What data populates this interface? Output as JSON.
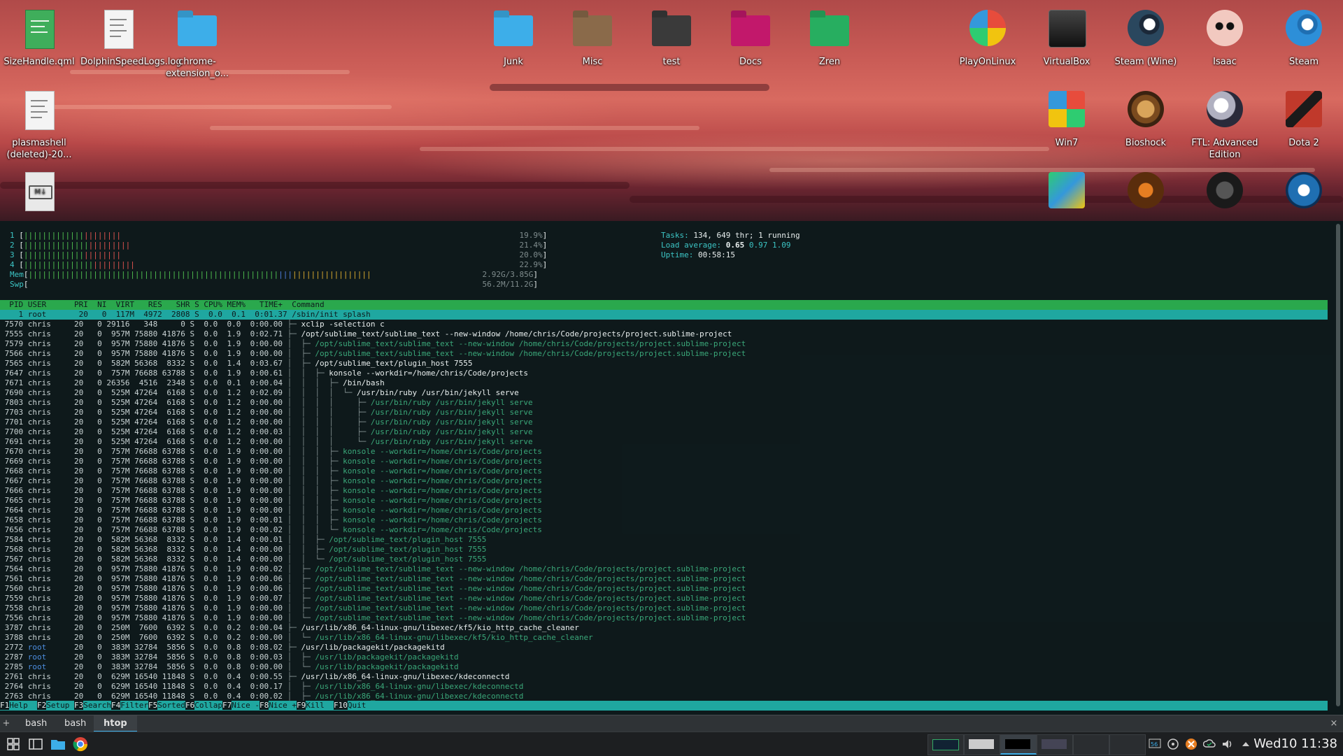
{
  "desktop": {
    "left_icons": [
      {
        "label": "SizeHandle.qml",
        "icon": "qml-file-icon"
      },
      {
        "label": "DolphinSpeedLogs.log",
        "icon": "log-file-icon"
      },
      {
        "label": "chrome-extension_o...",
        "icon": "folder-icon"
      },
      {
        "label": "plasmashell (deleted)-20...",
        "icon": "text-file-icon"
      },
      {
        "label": "",
        "icon": "markdown-file-icon"
      }
    ],
    "folders": [
      {
        "label": "Junk",
        "color": "#3daee9"
      },
      {
        "label": "Misc",
        "color": "#8a6a4a"
      },
      {
        "label": "test",
        "color": "#3a3a3a"
      },
      {
        "label": "Docs",
        "color": "#c2186b"
      },
      {
        "label": "Zren",
        "color": "#27ae60"
      }
    ],
    "apps_row1": [
      {
        "label": "PlayOnLinux",
        "icon": "playonlinux-icon"
      },
      {
        "label": "VirtualBox",
        "icon": "virtualbox-icon"
      },
      {
        "label": "Steam (Wine)",
        "icon": "steam-icon"
      },
      {
        "label": "Isaac",
        "icon": "isaac-icon"
      },
      {
        "label": "Steam",
        "icon": "steam-icon"
      }
    ],
    "apps_row2": [
      {
        "label": "Win7",
        "icon": "win7-icon"
      },
      {
        "label": "Bioshock",
        "icon": "bioshock-icon"
      },
      {
        "label": "FTL: Advanced Edition",
        "icon": "ftl-icon"
      },
      {
        "label": "Dota 2",
        "icon": "dota2-icon"
      }
    ],
    "apps_row3": [
      {
        "label": "",
        "icon": "game-icon"
      },
      {
        "label": "",
        "icon": "torchlight-icon"
      },
      {
        "label": "",
        "icon": "witcher-icon"
      },
      {
        "label": "",
        "icon": "rocket-league-icon"
      }
    ]
  },
  "htop": {
    "cpu_meters": [
      {
        "id": "1",
        "percent": "19.9%",
        "fill": 0.199
      },
      {
        "id": "2",
        "percent": "21.4%",
        "fill": 0.214
      },
      {
        "id": "3",
        "percent": "20.0%",
        "fill": 0.2
      },
      {
        "id": "4",
        "percent": "22.9%",
        "fill": 0.229
      }
    ],
    "mem": {
      "label": "Mem",
      "used": "2.92G",
      "total": "3.85G",
      "fill": 0.76
    },
    "swp": {
      "label": "Swp",
      "used": "56.2M",
      "total": "11.2G",
      "fill": 0.005
    },
    "tasks_label": "Tasks: ",
    "tasks_value": "134, 649 thr; 1 running",
    "load_label": "Load average: ",
    "load_1": "0.65",
    "load_rest": "0.97 1.09",
    "uptime_label": "Uptime: ",
    "uptime_value": "00:58:15",
    "header": "  PID USER      PRI  NI  VIRT   RES   SHR S CPU% MEM%   TIME+  Command",
    "selected_row": "    1 root       20   0  117M  4972  2808 S  0.0  0.1  0:01.37 /sbin/init splash",
    "rows": [
      {
        "pid": "7570",
        "user": "chris",
        "virt": "29116",
        "res": "348",
        "shr": "0",
        "cpu": "0.0",
        "mem": "0.0",
        "time": "0:00.00",
        "tree": "├─ ",
        "cmd": "xclip -selection c",
        "child": false
      },
      {
        "pid": "7555",
        "user": "chris",
        "virt": "957M",
        "res": "75880",
        "shr": "41876",
        "cpu": "0.0",
        "mem": "1.9",
        "time": "0:02.71",
        "tree": "├─ ",
        "cmd": "/opt/sublime_text/sublime_text --new-window /home/chris/Code/projects/project.sublime-project",
        "child": false
      },
      {
        "pid": "7579",
        "user": "chris",
        "virt": "957M",
        "res": "75880",
        "shr": "41876",
        "cpu": "0.0",
        "mem": "1.9",
        "time": "0:00.00",
        "tree": "│  ├─ ",
        "cmd": "/opt/sublime_text/sublime_text --new-window /home/chris/Code/projects/project.sublime-project",
        "child": true
      },
      {
        "pid": "7566",
        "user": "chris",
        "virt": "957M",
        "res": "75880",
        "shr": "41876",
        "cpu": "0.0",
        "mem": "1.9",
        "time": "0:00.00",
        "tree": "│  ├─ ",
        "cmd": "/opt/sublime_text/sublime_text --new-window /home/chris/Code/projects/project.sublime-project",
        "child": true
      },
      {
        "pid": "7565",
        "user": "chris",
        "virt": "582M",
        "res": "56368",
        "shr": "8332",
        "cpu": "0.0",
        "mem": "1.4",
        "time": "0:03.67",
        "tree": "│  ├─ ",
        "cmd": "/opt/sublime_text/plugin_host 7555",
        "child": false
      },
      {
        "pid": "7647",
        "user": "chris",
        "virt": "757M",
        "res": "76688",
        "shr": "63788",
        "cpu": "0.0",
        "mem": "1.9",
        "time": "0:00.61",
        "tree": "│  │  ├─ ",
        "cmd": "konsole --workdir=/home/chris/Code/projects",
        "child": false
      },
      {
        "pid": "7671",
        "user": "chris",
        "virt": "26356",
        "res": "4516",
        "shr": "2348",
        "cpu": "0.0",
        "mem": "0.1",
        "time": "0:00.04",
        "tree": "│  │  │  ├─ ",
        "cmd": "/bin/bash",
        "child": false
      },
      {
        "pid": "7690",
        "user": "chris",
        "virt": "525M",
        "res": "47264",
        "shr": "6168",
        "cpu": "0.0",
        "mem": "1.2",
        "time": "0:02.09",
        "tree": "│  │  │  │  └─ ",
        "cmd": "/usr/bin/ruby /usr/bin/jekyll serve",
        "child": false
      },
      {
        "pid": "7803",
        "user": "chris",
        "virt": "525M",
        "res": "47264",
        "shr": "6168",
        "cpu": "0.0",
        "mem": "1.2",
        "time": "0:00.00",
        "tree": "│  │  │  │     ├─ ",
        "cmd": "/usr/bin/ruby /usr/bin/jekyll serve",
        "child": true
      },
      {
        "pid": "7703",
        "user": "chris",
        "virt": "525M",
        "res": "47264",
        "shr": "6168",
        "cpu": "0.0",
        "mem": "1.2",
        "time": "0:00.00",
        "tree": "│  │  │  │     ├─ ",
        "cmd": "/usr/bin/ruby /usr/bin/jekyll serve",
        "child": true
      },
      {
        "pid": "7701",
        "user": "chris",
        "virt": "525M",
        "res": "47264",
        "shr": "6168",
        "cpu": "0.0",
        "mem": "1.2",
        "time": "0:00.00",
        "tree": "│  │  │  │     ├─ ",
        "cmd": "/usr/bin/ruby /usr/bin/jekyll serve",
        "child": true
      },
      {
        "pid": "7700",
        "user": "chris",
        "virt": "525M",
        "res": "47264",
        "shr": "6168",
        "cpu": "0.0",
        "mem": "1.2",
        "time": "0:00.03",
        "tree": "│  │  │  │     ├─ ",
        "cmd": "/usr/bin/ruby /usr/bin/jekyll serve",
        "child": true
      },
      {
        "pid": "7691",
        "user": "chris",
        "virt": "525M",
        "res": "47264",
        "shr": "6168",
        "cpu": "0.0",
        "mem": "1.2",
        "time": "0:00.00",
        "tree": "│  │  │  │     └─ ",
        "cmd": "/usr/bin/ruby /usr/bin/jekyll serve",
        "child": true
      },
      {
        "pid": "7670",
        "user": "chris",
        "virt": "757M",
        "res": "76688",
        "shr": "63788",
        "cpu": "0.0",
        "mem": "1.9",
        "time": "0:00.00",
        "tree": "│  │  │  ├─ ",
        "cmd": "konsole --workdir=/home/chris/Code/projects",
        "child": true
      },
      {
        "pid": "7669",
        "user": "chris",
        "virt": "757M",
        "res": "76688",
        "shr": "63788",
        "cpu": "0.0",
        "mem": "1.9",
        "time": "0:00.00",
        "tree": "│  │  │  ├─ ",
        "cmd": "konsole --workdir=/home/chris/Code/projects",
        "child": true
      },
      {
        "pid": "7668",
        "user": "chris",
        "virt": "757M",
        "res": "76688",
        "shr": "63788",
        "cpu": "0.0",
        "mem": "1.9",
        "time": "0:00.00",
        "tree": "│  │  │  ├─ ",
        "cmd": "konsole --workdir=/home/chris/Code/projects",
        "child": true
      },
      {
        "pid": "7667",
        "user": "chris",
        "virt": "757M",
        "res": "76688",
        "shr": "63788",
        "cpu": "0.0",
        "mem": "1.9",
        "time": "0:00.00",
        "tree": "│  │  │  ├─ ",
        "cmd": "konsole --workdir=/home/chris/Code/projects",
        "child": true
      },
      {
        "pid": "7666",
        "user": "chris",
        "virt": "757M",
        "res": "76688",
        "shr": "63788",
        "cpu": "0.0",
        "mem": "1.9",
        "time": "0:00.00",
        "tree": "│  │  │  ├─ ",
        "cmd": "konsole --workdir=/home/chris/Code/projects",
        "child": true
      },
      {
        "pid": "7665",
        "user": "chris",
        "virt": "757M",
        "res": "76688",
        "shr": "63788",
        "cpu": "0.0",
        "mem": "1.9",
        "time": "0:00.00",
        "tree": "│  │  │  ├─ ",
        "cmd": "konsole --workdir=/home/chris/Code/projects",
        "child": true
      },
      {
        "pid": "7664",
        "user": "chris",
        "virt": "757M",
        "res": "76688",
        "shr": "63788",
        "cpu": "0.0",
        "mem": "1.9",
        "time": "0:00.00",
        "tree": "│  │  │  ├─ ",
        "cmd": "konsole --workdir=/home/chris/Code/projects",
        "child": true
      },
      {
        "pid": "7658",
        "user": "chris",
        "virt": "757M",
        "res": "76688",
        "shr": "63788",
        "cpu": "0.0",
        "mem": "1.9",
        "time": "0:00.01",
        "tree": "│  │  │  ├─ ",
        "cmd": "konsole --workdir=/home/chris/Code/projects",
        "child": true
      },
      {
        "pid": "7656",
        "user": "chris",
        "virt": "757M",
        "res": "76688",
        "shr": "63788",
        "cpu": "0.0",
        "mem": "1.9",
        "time": "0:00.02",
        "tree": "│  │  │  └─ ",
        "cmd": "konsole --workdir=/home/chris/Code/projects",
        "child": true
      },
      {
        "pid": "7584",
        "user": "chris",
        "virt": "582M",
        "res": "56368",
        "shr": "8332",
        "cpu": "0.0",
        "mem": "1.4",
        "time": "0:00.01",
        "tree": "│  │  ├─ ",
        "cmd": "/opt/sublime_text/plugin_host 7555",
        "child": true
      },
      {
        "pid": "7568",
        "user": "chris",
        "virt": "582M",
        "res": "56368",
        "shr": "8332",
        "cpu": "0.0",
        "mem": "1.4",
        "time": "0:00.00",
        "tree": "│  │  ├─ ",
        "cmd": "/opt/sublime_text/plugin_host 7555",
        "child": true
      },
      {
        "pid": "7567",
        "user": "chris",
        "virt": "582M",
        "res": "56368",
        "shr": "8332",
        "cpu": "0.0",
        "mem": "1.4",
        "time": "0:00.00",
        "tree": "│  │  └─ ",
        "cmd": "/opt/sublime_text/plugin_host 7555",
        "child": true
      },
      {
        "pid": "7564",
        "user": "chris",
        "virt": "957M",
        "res": "75880",
        "shr": "41876",
        "cpu": "0.0",
        "mem": "1.9",
        "time": "0:00.02",
        "tree": "│  ├─ ",
        "cmd": "/opt/sublime_text/sublime_text --new-window /home/chris/Code/projects/project.sublime-project",
        "child": true
      },
      {
        "pid": "7561",
        "user": "chris",
        "virt": "957M",
        "res": "75880",
        "shr": "41876",
        "cpu": "0.0",
        "mem": "1.9",
        "time": "0:00.06",
        "tree": "│  ├─ ",
        "cmd": "/opt/sublime_text/sublime_text --new-window /home/chris/Code/projects/project.sublime-project",
        "child": true
      },
      {
        "pid": "7560",
        "user": "chris",
        "virt": "957M",
        "res": "75880",
        "shr": "41876",
        "cpu": "0.0",
        "mem": "1.9",
        "time": "0:00.06",
        "tree": "│  ├─ ",
        "cmd": "/opt/sublime_text/sublime_text --new-window /home/chris/Code/projects/project.sublime-project",
        "child": true
      },
      {
        "pid": "7559",
        "user": "chris",
        "virt": "957M",
        "res": "75880",
        "shr": "41876",
        "cpu": "0.0",
        "mem": "1.9",
        "time": "0:00.07",
        "tree": "│  ├─ ",
        "cmd": "/opt/sublime_text/sublime_text --new-window /home/chris/Code/projects/project.sublime-project",
        "child": true
      },
      {
        "pid": "7558",
        "user": "chris",
        "virt": "957M",
        "res": "75880",
        "shr": "41876",
        "cpu": "0.0",
        "mem": "1.9",
        "time": "0:00.00",
        "tree": "│  ├─ ",
        "cmd": "/opt/sublime_text/sublime_text --new-window /home/chris/Code/projects/project.sublime-project",
        "child": true
      },
      {
        "pid": "7556",
        "user": "chris",
        "virt": "957M",
        "res": "75880",
        "shr": "41876",
        "cpu": "0.0",
        "mem": "1.9",
        "time": "0:00.00",
        "tree": "│  └─ ",
        "cmd": "/opt/sublime_text/sublime_text --new-window /home/chris/Code/projects/project.sublime-project",
        "child": true
      },
      {
        "pid": "3787",
        "user": "chris",
        "virt": "250M",
        "res": "7600",
        "shr": "6392",
        "cpu": "0.0",
        "mem": "0.2",
        "time": "0:00.04",
        "tree": "├─ ",
        "cmd": "/usr/lib/x86_64-linux-gnu/libexec/kf5/kio_http_cache_cleaner",
        "child": false
      },
      {
        "pid": "3788",
        "user": "chris",
        "virt": "250M",
        "res": "7600",
        "shr": "6392",
        "cpu": "0.0",
        "mem": "0.2",
        "time": "0:00.00",
        "tree": "│  └─ ",
        "cmd": "/usr/lib/x86_64-linux-gnu/libexec/kf5/kio_http_cache_cleaner",
        "child": true
      },
      {
        "pid": "2772",
        "user": "root",
        "virt": "383M",
        "res": "32784",
        "shr": "5856",
        "cpu": "0.0",
        "mem": "0.8",
        "time": "0:08.02",
        "tree": "├─ ",
        "cmd": "/usr/lib/packagekit/packagekitd",
        "child": false
      },
      {
        "pid": "2787",
        "user": "root",
        "virt": "383M",
        "res": "32784",
        "shr": "5856",
        "cpu": "0.0",
        "mem": "0.8",
        "time": "0:00.03",
        "tree": "│  ├─ ",
        "cmd": "/usr/lib/packagekit/packagekitd",
        "child": true
      },
      {
        "pid": "2785",
        "user": "root",
        "virt": "383M",
        "res": "32784",
        "shr": "5856",
        "cpu": "0.0",
        "mem": "0.8",
        "time": "0:00.00",
        "tree": "│  └─ ",
        "cmd": "/usr/lib/packagekit/packagekitd",
        "child": true
      },
      {
        "pid": "2761",
        "user": "chris",
        "virt": "629M",
        "res": "16540",
        "shr": "11848",
        "cpu": "0.0",
        "mem": "0.4",
        "time": "0:00.55",
        "tree": "├─ ",
        "cmd": "/usr/lib/x86_64-linux-gnu/libexec/kdeconnectd",
        "child": false
      },
      {
        "pid": "2764",
        "user": "chris",
        "virt": "629M",
        "res": "16540",
        "shr": "11848",
        "cpu": "0.0",
        "mem": "0.4",
        "time": "0:00.17",
        "tree": "│  ├─ ",
        "cmd": "/usr/lib/x86_64-linux-gnu/libexec/kdeconnectd",
        "child": true
      },
      {
        "pid": "2763",
        "user": "chris",
        "virt": "629M",
        "res": "16540",
        "shr": "11848",
        "cpu": "0.0",
        "mem": "0.4",
        "time": "0:00.02",
        "tree": "│  ├─ ",
        "cmd": "/usr/lib/x86_64-linux-gnu/libexec/kdeconnectd",
        "child": true
      }
    ],
    "fkeys": [
      {
        "key": "F1",
        "label": "Help  "
      },
      {
        "key": "F2",
        "label": "Setup "
      },
      {
        "key": "F3",
        "label": "Search"
      },
      {
        "key": "F4",
        "label": "Filter"
      },
      {
        "key": "F5",
        "label": "Sorted"
      },
      {
        "key": "F6",
        "label": "Collap"
      },
      {
        "key": "F7",
        "label": "Nice -"
      },
      {
        "key": "F8",
        "label": "Nice +"
      },
      {
        "key": "F9",
        "label": "Kill  "
      },
      {
        "key": "F10",
        "label": "Quit  "
      }
    ]
  },
  "konsole_tabs": [
    "bash",
    "bash",
    "htop"
  ],
  "panel": {
    "clock": "Wed10 11:38",
    "colors": {
      "accent": "#3daee9"
    }
  }
}
